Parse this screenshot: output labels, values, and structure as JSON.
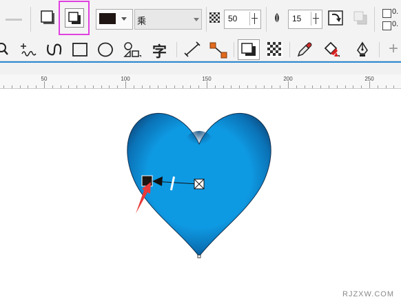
{
  "property_bar": {
    "blend_mode": "乘",
    "transparency_value": "50",
    "feather_value": "15",
    "fill_color": "#1f1512",
    "right_values": [
      "0.",
      "0."
    ],
    "highlight_color": "#e040e0"
  },
  "toolbar": {
    "text_tool_glyph": "字",
    "add_glyph": "+"
  },
  "ruler": {
    "labels": [
      "50",
      "100",
      "150",
      "200",
      "250"
    ]
  },
  "canvas": {
    "heart_color": "#0e9ae3",
    "heart_shadow_color": "#0d4e85"
  },
  "watermark": "RJZXW.COM"
}
